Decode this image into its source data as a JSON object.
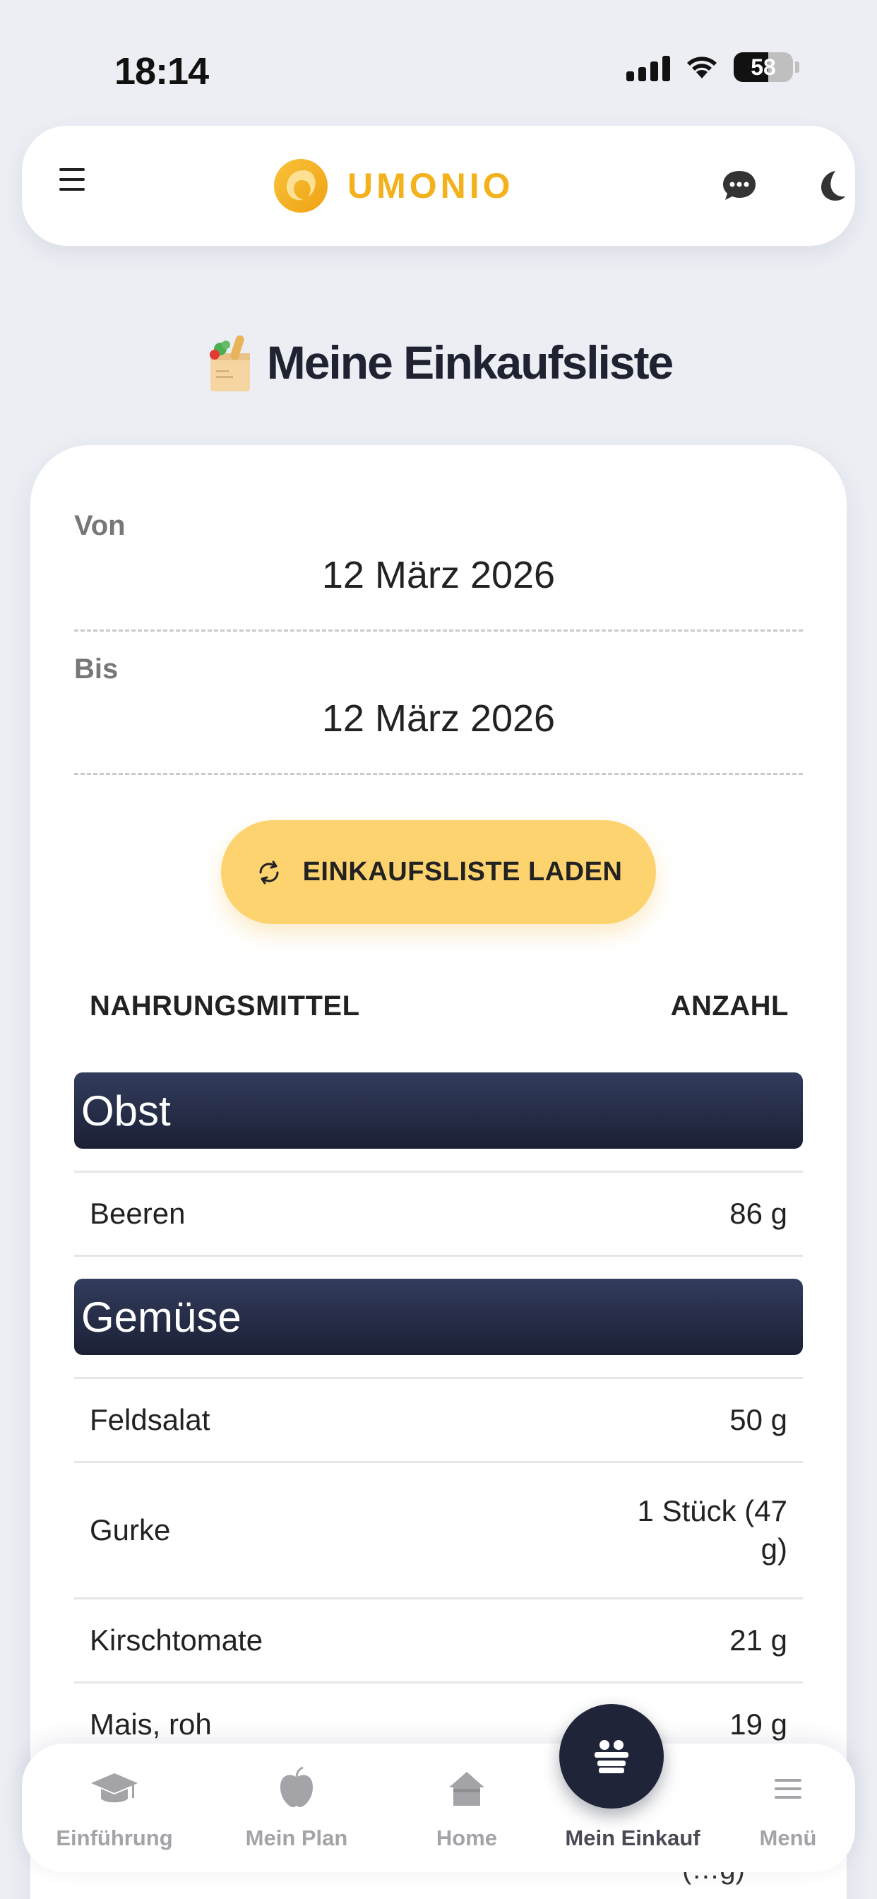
{
  "status_bar": {
    "time": "18:14",
    "battery": "58",
    "battery_level": 0.58
  },
  "header": {
    "brand": "UMONIO"
  },
  "page": {
    "title": "Meine Einkaufsliste"
  },
  "date_range": {
    "from_label": "Von",
    "from_value": "12 März 2026",
    "to_label": "Bis",
    "to_value": "12 März 2026"
  },
  "load_button": {
    "label": "EINKAUFSLISTE LADEN"
  },
  "table": {
    "col_food": "NAHRUNGSMITTEL",
    "col_amount": "ANZAHL",
    "categories": [
      {
        "name": "Obst",
        "items": [
          {
            "name": "Beeren",
            "amount": "86 g"
          }
        ]
      },
      {
        "name": "Gemüse",
        "items": [
          {
            "name": "Feldsalat",
            "amount": "50 g"
          },
          {
            "name": "Gurke",
            "amount_line1": "1 Stück (47",
            "amount_line2": "g)"
          },
          {
            "name": "Kirschtomate",
            "amount": "21 g"
          },
          {
            "name": "Mais, roh",
            "amount": "19 g"
          }
        ]
      }
    ],
    "partial_text_behind_nav": "(…g)"
  },
  "bottom_nav": {
    "items": [
      {
        "label": "Einführung",
        "icon": "graduation-cap-icon"
      },
      {
        "label": "Mein Plan",
        "icon": "apple-icon"
      },
      {
        "label": "Home",
        "icon": "home-icon"
      },
      {
        "label": "Mein Einkauf",
        "icon": "shopping-basket-icon",
        "active": true
      },
      {
        "label": "Menü",
        "icon": "menu-icon"
      }
    ]
  },
  "colors": {
    "accent": "#f3b11c",
    "button": "#fdd36f",
    "category_header": "#1b2035",
    "nav_active": "#4a4a55"
  }
}
